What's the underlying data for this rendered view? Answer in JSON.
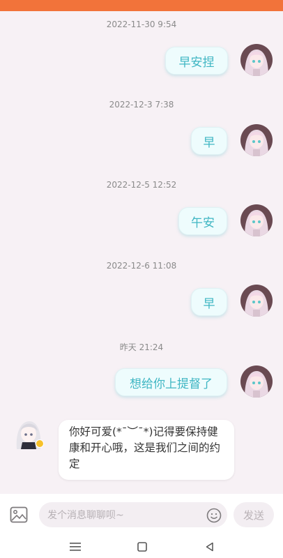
{
  "messages": [
    {
      "time": "2022-11-30 9:54",
      "text": "早安捏"
    },
    {
      "time": "2022-12-3 7:38",
      "text": "早"
    },
    {
      "time": "2022-12-5 12:52",
      "text": "午安"
    },
    {
      "time": "2022-12-6 11:08",
      "text": "早"
    },
    {
      "time": "昨天 21:24",
      "text": "想给你上提督了"
    }
  ],
  "reply": {
    "text": "你好可爱(*¯︶¯*)记得要保持健康和开心哦，这是我们之间的约定"
  },
  "input": {
    "placeholder": "发个消息聊聊呗~",
    "send_label": "发送",
    "image_icon": "image-icon",
    "emoji_icon": "emoji-icon"
  },
  "navigation": {
    "menu_icon": "menu-icon",
    "home_icon": "home-square-icon",
    "back_icon": "back-triangle-icon"
  },
  "colors": {
    "topbar": "#f2733a",
    "bubble_text": "#3fb6c3",
    "bubble_bg": "#eefcfd",
    "background": "#f7f1f5"
  }
}
